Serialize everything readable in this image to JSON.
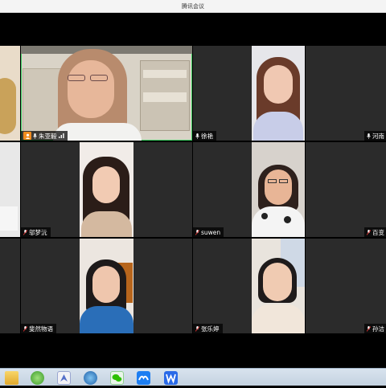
{
  "window": {
    "title": "腾讯会议"
  },
  "participants": [
    {
      "name": "朱亚毅",
      "host": true
    },
    {
      "name": "徐艳"
    },
    {
      "name": "河南"
    },
    {
      "name": "邬梦沅"
    },
    {
      "name": "suwen"
    },
    {
      "name": "百变"
    },
    {
      "name": "斐然物语"
    },
    {
      "name": "张乐婷"
    },
    {
      "name": "孙洁"
    }
  ],
  "taskbar": {
    "icons": [
      "folder-icon",
      "network-icon",
      "app-icon",
      "browser-icon",
      "wechat-icon",
      "tencent-meeting-icon",
      "wps-icon"
    ]
  },
  "colors": {
    "accent": "#3ecf63",
    "host_badge": "#f08c1e",
    "tile_bg": "#2b2b2b"
  }
}
